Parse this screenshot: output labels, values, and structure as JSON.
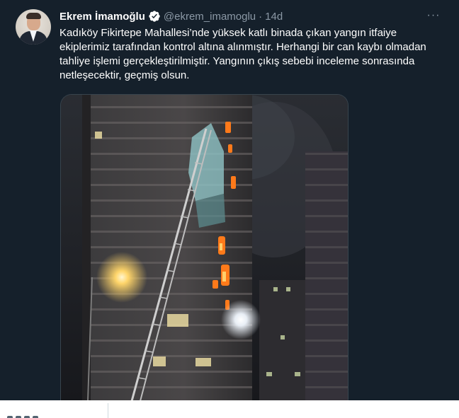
{
  "tweet": {
    "author_name": "Ekrem İmamoğlu",
    "handle": "@ekrem_imamoglu",
    "separator": "·",
    "time": "14d",
    "more_label": "···",
    "text": "Kadıköy Fikirtepe Mahallesi’nde yüksek katlı binada çıkan yangın itfaiye ekiplerimiz tarafından kontrol altına alınmıştır. Herhangi bir can kaybı olmadan tahliye işlemi gerçekleştirilmiştir. Yangının çıkış sebebi inceleme sonrasında netleşecektir, geçmiş olsun.",
    "verified_icon": "verified-badge-icon",
    "media_icon": "building-fire-photo"
  },
  "colors": {
    "background": "#15202b",
    "secondary_text": "#8b98a5",
    "verified": "#ffffff",
    "fire": "#ff7a1a"
  }
}
